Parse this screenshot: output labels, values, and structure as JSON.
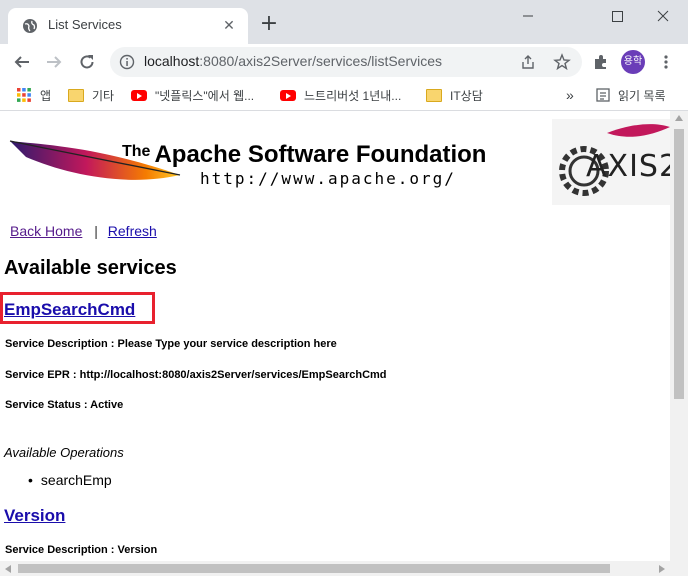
{
  "browser": {
    "tab_title": "List Services",
    "new_tab": "+",
    "url_host": "localhost",
    "url_path": ":8080/axis2Server/services/listServices",
    "avatar_text": "용학",
    "icons": [
      "globe-icon",
      "close-icon",
      "back-icon",
      "forward-icon",
      "reload-icon",
      "info-icon",
      "share-icon",
      "star-icon",
      "extensions-icon",
      "menu-icon",
      "minimize-icon",
      "maximize-icon",
      "close-window-icon"
    ]
  },
  "bookmarks": {
    "items": [
      {
        "label": "앱",
        "icon": "apps-grid-icon"
      },
      {
        "label": "기타",
        "icon": "folder-icon"
      },
      {
        "label": "\"넷플릭스\"에서 웹...",
        "icon": "youtube-icon"
      },
      {
        "label": "느트리버섯 1년내...",
        "icon": "youtube-icon"
      },
      {
        "label": "IT상담",
        "icon": "folder-icon"
      }
    ],
    "more": "»",
    "reading_list": "읽기 목록"
  },
  "page": {
    "banner_the": "The",
    "banner_title": "Apache Software Foundation",
    "banner_url": "http://www.apache.org/",
    "logo_text": "AXIS2",
    "back_home": "Back Home",
    "separator": "|",
    "refresh": "Refresh",
    "heading": "Available services",
    "services": [
      {
        "name": "EmpSearchCmd",
        "description": "Service Description : Please Type your service description here",
        "epr": "Service EPR : http://localhost:8080/axis2Server/services/EmpSearchCmd",
        "status": "Service Status : Active",
        "ops_title": "Available Operations",
        "operations": [
          "searchEmp"
        ]
      },
      {
        "name": "Version",
        "description": "Service Description : Version"
      }
    ]
  },
  "colors": {
    "highlight": "#e8212e",
    "link": "#1a0dab",
    "visited": "#551a8b"
  }
}
